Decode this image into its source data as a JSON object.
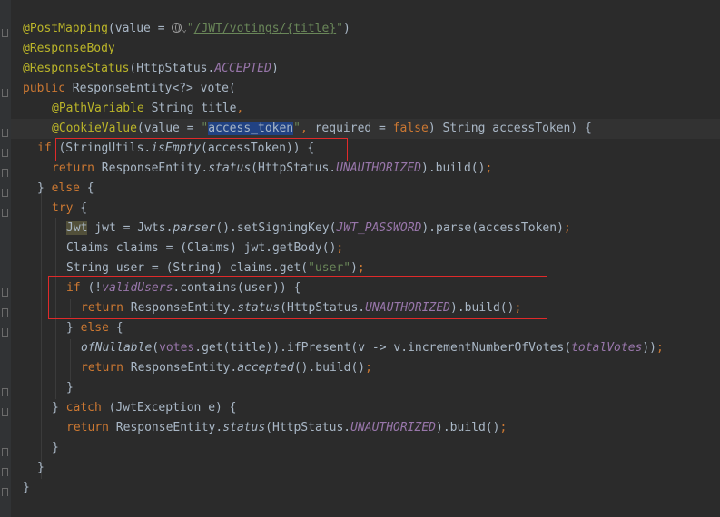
{
  "code": {
    "l1": {
      "ann": "@PostMapping",
      "a": "(value = ",
      "q1": "\"",
      "url": "/JWT/votings/{title}",
      "q2": "\"",
      "b": ")"
    },
    "l2": {
      "ann": "@ResponseBody"
    },
    "l3": {
      "ann": "@ResponseStatus",
      "a": "(HttpStatus.",
      "const": "ACCEPTED",
      "b": ")"
    },
    "l4": {
      "kw": "public",
      "a": " ResponseEntity<?> vote("
    },
    "l5": {
      "ann": "@PathVariable",
      "a": " String title",
      "comma": ","
    },
    "l6": {
      "ann": "@CookieValue",
      "a": "(value = ",
      "q1": "\"",
      "sel": "access_token",
      "q2": "\"",
      "comma": ",",
      "b": " required = ",
      "kw": "false",
      "c": ") String accessToken) {"
    },
    "l7": {
      "kw": "if",
      "a": " (StringUtils.",
      "method": "isEmpty",
      "b": "(accessToken)) {"
    },
    "l8": {
      "kw": "return",
      "a": " ResponseEntity.",
      "method": "status",
      "b": "(HttpStatus.",
      "const": "UNAUTHORIZED",
      "c": ").build()",
      "semi": ";"
    },
    "l9": {
      "a": "} ",
      "kw": "else",
      "b": " {"
    },
    "l10": {
      "kw": "try",
      "a": " {"
    },
    "l11": {
      "jwt": "Jwt",
      "a": " jwt = Jwts.",
      "method": "parser",
      "b": "().setSigningKey(",
      "const": "JWT_PASSWORD",
      "c": ").parse(accessToken)",
      "semi": ";"
    },
    "l12": {
      "a": "Claims claims = (Claims) jwt.getBody()",
      "semi": ";"
    },
    "l13": {
      "a": "String user = (String) claims.get(",
      "str": "\"user\"",
      "b": ")",
      "semi": ";"
    },
    "l14": {
      "kw": "if",
      "a": " (!",
      "fld": "validUsers",
      "b": ".contains(user)) {"
    },
    "l15": {
      "kw": "return",
      "a": " ResponseEntity.",
      "method": "status",
      "b": "(HttpStatus.",
      "const": "UNAUTHORIZED",
      "c": ").build()",
      "semi": ";"
    },
    "l16": {
      "a": "} ",
      "kw": "else",
      "b": " {"
    },
    "l17": {
      "method": "ofNullable",
      "a": "(",
      "fld": "votes",
      "b": ".get(title)).ifPresent(v -> v.incrementNumberOfVotes(",
      "fld2": "totalVotes",
      "c": "))",
      "semi": ";"
    },
    "l18": {
      "kw": "return",
      "a": " ResponseEntity.",
      "method": "accepted",
      "b": "().build()",
      "semi": ";"
    },
    "l19": {
      "a": "}"
    },
    "l20": {
      "a": "} ",
      "kw": "catch",
      "b": " (JwtException e) {"
    },
    "l21": {
      "kw": "return",
      "a": " ResponseEntity.",
      "method": "status",
      "b": "(HttpStatus.",
      "const": "UNAUTHORIZED",
      "c": ").build()",
      "semi": ";"
    },
    "l22": {
      "a": "}"
    },
    "l23": {
      "a": "}"
    },
    "l24": {
      "a": "}"
    }
  },
  "colors": {
    "background": "#2b2b2b",
    "keyword": "#cc7832",
    "annotation": "#bbb529",
    "string": "#6a8759",
    "constant": "#9876aa",
    "text": "#a9b7c6",
    "highlight_box": "#e02a2a",
    "selection": "#214283"
  },
  "icons": [
    "globe-icon",
    "chevron-down-icon"
  ]
}
